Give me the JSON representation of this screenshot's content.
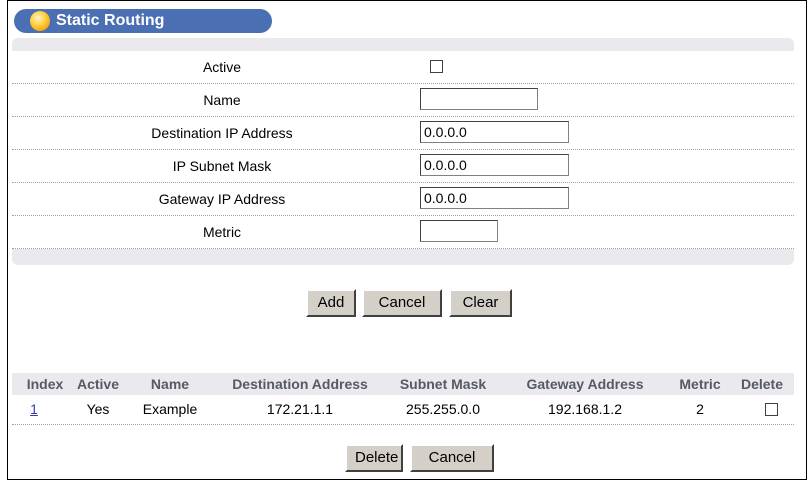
{
  "header": {
    "title": "Static Routing"
  },
  "form": {
    "active_label": "Active",
    "name_label": "Name",
    "name_value": "",
    "dest_label": "Destination IP Address",
    "dest_value": "0.0.0.0",
    "mask_label": "IP Subnet Mask",
    "mask_value": "0.0.0.0",
    "gateway_label": "Gateway IP Address",
    "gateway_value": "0.0.0.0",
    "metric_label": "Metric",
    "metric_value": ""
  },
  "form_buttons": {
    "add": "Add",
    "cancel": "Cancel",
    "clear": "Clear"
  },
  "table": {
    "columns": [
      "Index",
      "Active",
      "Name",
      "Destination Address",
      "Subnet Mask",
      "Gateway Address",
      "Metric",
      "Delete"
    ],
    "rows": [
      {
        "index": "1",
        "active": "Yes",
        "name": "Example",
        "destination": "172.21.1.1",
        "mask": "255.255.0.0",
        "gateway": "192.168.1.2",
        "metric": "2"
      }
    ]
  },
  "table_buttons": {
    "delete": "Delete",
    "cancel": "Cancel"
  }
}
